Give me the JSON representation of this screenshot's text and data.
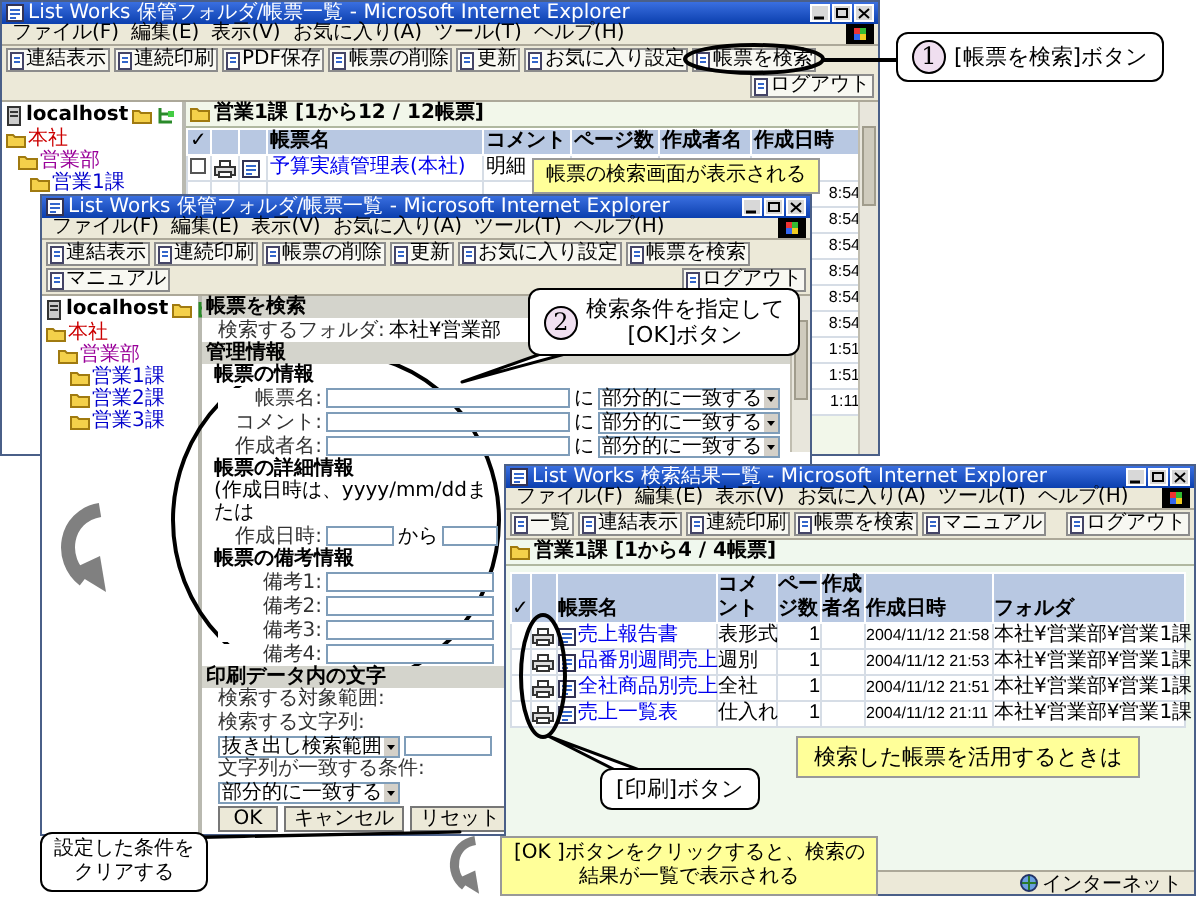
{
  "windows": [
    {
      "kind": "list",
      "title": "List Works 保管フォルダ/帳票一覧 - Microsoft Internet Explorer",
      "menu": [
        "ファイル(F)",
        "編集(E)",
        "表示(V)",
        "お気に入り(A)",
        "ツール(T)",
        "ヘルプ(H)"
      ],
      "toolbar": [
        "連結表示",
        "連続印刷",
        "PDF保存",
        "帳票の削除",
        "更新",
        "お気に入り設定",
        "帳票を検索"
      ],
      "logout": "ログアウト",
      "host": "localhost",
      "tree": [
        {
          "label": "本社",
          "children": [
            {
              "label": "営業部",
              "children": [
                {
                  "label": "営業1課"
                }
              ]
            }
          ]
        }
      ],
      "list_title": "営業1課 [1から12 / 12帳票]",
      "columns": [
        "✓",
        "帳票名",
        "コメント",
        "ページ数",
        "作成者名",
        "作成日時"
      ],
      "rows": [
        {
          "checked": false,
          "name": "予算実績管理表(本社)",
          "comment": "明細"
        },
        {
          "time": "8:54"
        },
        {
          "time": "8:54"
        },
        {
          "time": "8:54"
        },
        {
          "time": "8:54"
        },
        {
          "time": "8:54"
        },
        {
          "time": "8:54"
        },
        {
          "time": "1:51"
        },
        {
          "time": "1:51"
        },
        {
          "time": "1:11"
        }
      ]
    },
    {
      "kind": "search",
      "title": "List Works 保管フォルダ/帳票一覧 - Microsoft Internet Explorer",
      "menu": [
        "ファイル(F)",
        "編集(E)",
        "表示(V)",
        "お気に入り(A)",
        "ツール(T)",
        "ヘルプ(H)"
      ],
      "toolbar": [
        "連結表示",
        "連続印刷",
        "帳票の削除",
        "更新",
        "お気に入り設定",
        "帳票を検索",
        "マニュアル"
      ],
      "logout": "ログアウト",
      "host": "localhost",
      "tree": [
        {
          "label": "本社",
          "children": [
            {
              "label": "営業部",
              "children": [
                {
                  "label": "営業1課"
                },
                {
                  "label": "営業2課"
                },
                {
                  "label": "営業3課"
                }
              ]
            }
          ]
        }
      ],
      "heading": "帳票を検索",
      "folder_label": "検索するフォルダ:",
      "folder": "本社¥営業部",
      "sections": [
        {
          "kind": "header",
          "label": "管理情報"
        },
        {
          "kind": "subheader",
          "label": "帳票の情報"
        },
        {
          "kind": "text_match",
          "label": "帳票名:",
          "joiner": "に",
          "option": "部分的に一致する"
        },
        {
          "kind": "text_match",
          "label": "コメント:",
          "joiner": "に",
          "option": "部分的に一致する"
        },
        {
          "kind": "text_match",
          "label": "作成者名:",
          "joiner": "に",
          "option": "部分的に一致する"
        },
        {
          "kind": "subheader",
          "label": "帳票の詳細情報",
          "note": "(作成日時は、yyyy/mm/ddまたは"
        },
        {
          "kind": "range",
          "label": "作成日時:",
          "joiner": "から"
        },
        {
          "kind": "subheader",
          "label": "帳票の備考情報"
        },
        {
          "kind": "text",
          "label": "備考1:"
        },
        {
          "kind": "text",
          "label": "備考2:"
        },
        {
          "kind": "text",
          "label": "備考3:"
        },
        {
          "kind": "text",
          "label": "備考4:"
        },
        {
          "kind": "header",
          "label": "印刷データ内の文字"
        },
        {
          "kind": "labels",
          "labels": [
            "検索する対象範囲:",
            "検索する文字列:"
          ]
        },
        {
          "kind": "scope",
          "option": "抜き出し検索範囲"
        },
        {
          "kind": "condition",
          "label": "文字列が一致する条件:",
          "option": "部分的に一致する"
        },
        {
          "kind": "buttons",
          "buttons": [
            "OK",
            "キャンセル",
            "リセット"
          ]
        }
      ]
    },
    {
      "kind": "results",
      "title": "List Works 検索結果一覧 - Microsoft Internet Explorer",
      "menu": [
        "ファイル(F)",
        "編集(E)",
        "表示(V)",
        "お気に入り(A)",
        "ツール(T)",
        "ヘルプ(H)"
      ],
      "toolbar": [
        "一覧",
        "連結表示",
        "連続印刷",
        "帳票を検索",
        "マニュアル"
      ],
      "logout": "ログアウト",
      "list_title": "営業1課 [1から4 / 4帳票]",
      "columns": [
        "✓",
        "帳票名",
        "コメント",
        "ページ数",
        "作成者名",
        "作成日時",
        "フォルダ"
      ],
      "rows": [
        {
          "name": "売上報告書",
          "comment": "表形式",
          "pages": "1",
          "date": "2004/11/12 21:58",
          "folder": "本社¥営業部¥営業1課"
        },
        {
          "name": "品番別週間売上",
          "comment": "週別",
          "pages": "1",
          "date": "2004/11/12 21:53",
          "folder": "本社¥営業部¥営業1課"
        },
        {
          "name": "全社商品別売上",
          "comment": "全社",
          "pages": "1",
          "date": "2004/11/12 21:51",
          "folder": "本社¥営業部¥営業1課"
        },
        {
          "name": "売上一覧表",
          "comment": "仕入れ",
          "pages": "1",
          "date": "2004/11/12 21:11",
          "folder": "本社¥営業部¥営業1課"
        }
      ],
      "status": "インターネット"
    }
  ],
  "callouts": [
    {
      "kind": "numbered",
      "number": "1",
      "lines": [
        "[帳票を検索]ボタン"
      ]
    },
    {
      "kind": "note",
      "lines": [
        "帳票の検索画面が表示される"
      ]
    },
    {
      "kind": "numbered",
      "number": "2",
      "lines": [
        "検索条件を指定して",
        "[OK]ボタン"
      ]
    },
    {
      "kind": "bubble",
      "lines": [
        "設定した条件を",
        "クリアする"
      ]
    },
    {
      "kind": "note",
      "lines": [
        "[OK ]ボタンをクリックすると、検索の",
        "結果が一覧で表示される"
      ]
    },
    {
      "kind": "note",
      "lines": [
        "検索した帳票を活用するときは"
      ]
    },
    {
      "kind": "bubble",
      "lines": [
        "[印刷]ボタン"
      ]
    }
  ]
}
